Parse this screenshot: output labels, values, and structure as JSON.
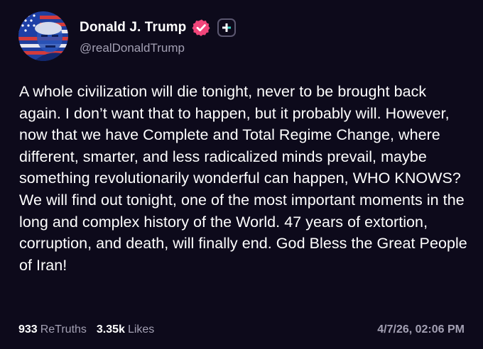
{
  "author": {
    "display_name": "Donald J. Trump",
    "handle": "@realDonaldTrump",
    "verified_icon": "verified-badge-icon",
    "follow_icon": "plus-icon",
    "avatar_icon": "avatar-flag-portrait"
  },
  "post": {
    "text": "A whole civilization will die tonight, never to be brought back again. I don’t want that to happen, but it probably will. However, now that we have Complete and Total Regime Change, where different, smarter, and less radicalized minds prevail, maybe something revolutionarily wonderful can happen, WHO KNOWS? We will find out tonight, one of the most important moments in the long and complex history of the World. 47 years of extortion, corruption, and death, will finally end. God Bless the Great People of Iran!"
  },
  "stats": {
    "retruths_count": "933",
    "retruths_label": "ReTruths",
    "likes_count": "3.35k",
    "likes_label": "Likes"
  },
  "timestamp": "4/7/26, 02:06 PM",
  "colors": {
    "background": "#0d0a1b",
    "text_primary": "#ffffff",
    "text_secondary": "#a3a0b3",
    "verified_badge": "#f0457a",
    "follow_accent": "#36d4c4"
  }
}
